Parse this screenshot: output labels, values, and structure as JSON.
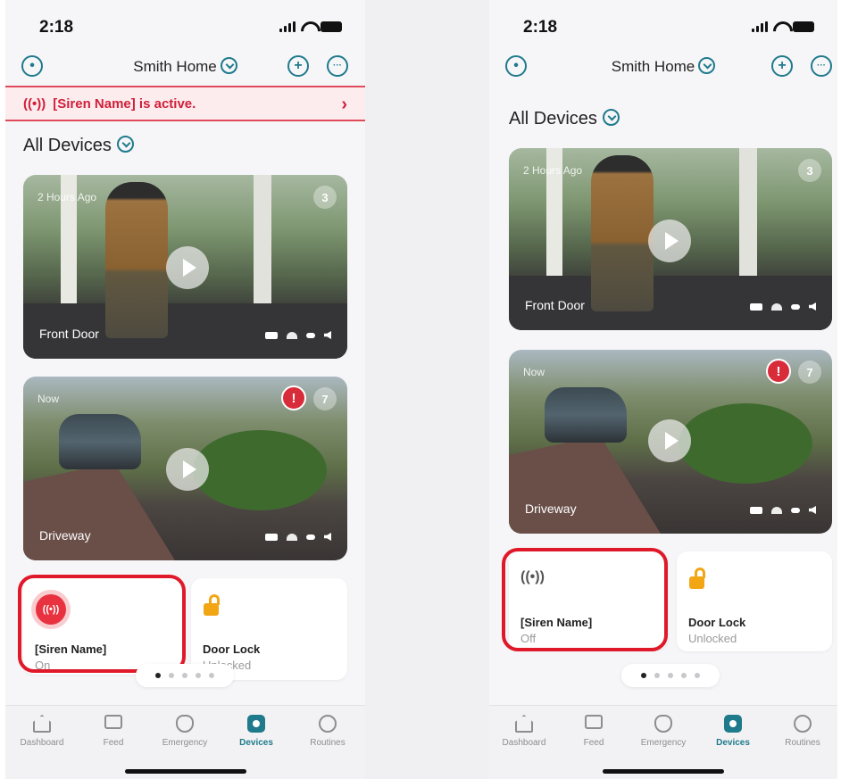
{
  "left": {
    "status_time": "2:18",
    "header_title": "Smith Home",
    "alert_icon": "((•))",
    "alert_text": "[Siren Name] is active.",
    "section_title": "All Devices",
    "cameras": [
      {
        "time": "2 Hours Ago",
        "count": "3",
        "name": "Front Door"
      },
      {
        "time": "Now",
        "count": "7",
        "name": "Driveway",
        "alert": "!"
      }
    ],
    "tiles": [
      {
        "icon_text": "((•))",
        "name": "[Siren Name]",
        "status": "On"
      },
      {
        "name": "Door Lock",
        "status": "Unlocked"
      }
    ]
  },
  "right": {
    "status_time": "2:18",
    "header_title": "Smith Home",
    "section_title": "All Devices",
    "cameras": [
      {
        "time": "2 Hours Ago",
        "count": "3",
        "name": "Front Door"
      },
      {
        "time": "Now",
        "count": "7",
        "name": "Driveway",
        "alert": "!"
      }
    ],
    "tiles": [
      {
        "icon_text": "((•))",
        "name": "[Siren Name]",
        "status": "Off"
      },
      {
        "name": "Door Lock",
        "status": "Unlocked"
      }
    ]
  },
  "tabs": [
    {
      "label": "Dashboard",
      "icon": "house-icon"
    },
    {
      "label": "Feed",
      "icon": "monitor-icon"
    },
    {
      "label": "Emergency",
      "icon": "shield-icon"
    },
    {
      "label": "Devices",
      "icon": "camera-icon",
      "active": true
    },
    {
      "label": "Routines",
      "icon": "routine-icon"
    }
  ],
  "header_icons": {
    "left": "profile-icon",
    "add": "+",
    "more": "···"
  },
  "colors": {
    "accent": "#1f7a8c",
    "alert": "#d0203a",
    "highlight_outline": "#e0192a",
    "lock": "#f2a614"
  }
}
